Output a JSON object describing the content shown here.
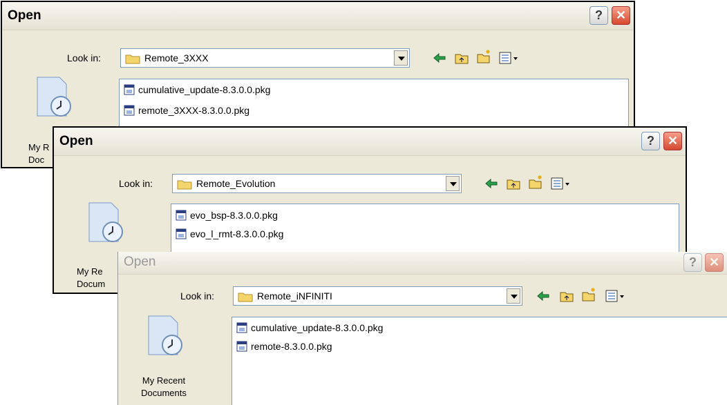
{
  "dialogs": [
    {
      "title": "Open",
      "help_label": "?",
      "close_label": "✕",
      "look_in_label": "Look in:",
      "look_in_value": "Remote_3XXX",
      "places": {
        "recent_line1": "My R",
        "recent_line2": "Doc"
      },
      "files": [
        "cumulative_update-8.3.0.0.pkg",
        "remote_3XXX-8.3.0.0.pkg"
      ]
    },
    {
      "title": "Open",
      "help_label": "?",
      "close_label": "✕",
      "look_in_label": "Look in:",
      "look_in_value": "Remote_Evolution",
      "places": {
        "recent_line1": "My Re",
        "recent_line2": "Docum"
      },
      "files": [
        "evo_bsp-8.3.0.0.pkg",
        "evo_l_rmt-8.3.0.0.pkg"
      ]
    },
    {
      "title": "Open",
      "help_label": "?",
      "close_label": "✕",
      "look_in_label": "Look in:",
      "look_in_value": "Remote_iNFINITI",
      "places": {
        "recent_line1": "My Recent",
        "recent_line2": "Documents"
      },
      "files": [
        "cumulative_update-8.3.0.0.pkg",
        "remote-8.3.0.0.pkg"
      ]
    }
  ],
  "icons": [
    "folder-icon",
    "back-arrow-icon",
    "up-folder-icon",
    "new-folder-icon",
    "view-menu-icon",
    "package-file-icon",
    "recent-documents-icon"
  ],
  "colors": {
    "dialog_bg": "#ece9d8",
    "close_red": "#d6492f",
    "field_border": "#7f9db9"
  }
}
